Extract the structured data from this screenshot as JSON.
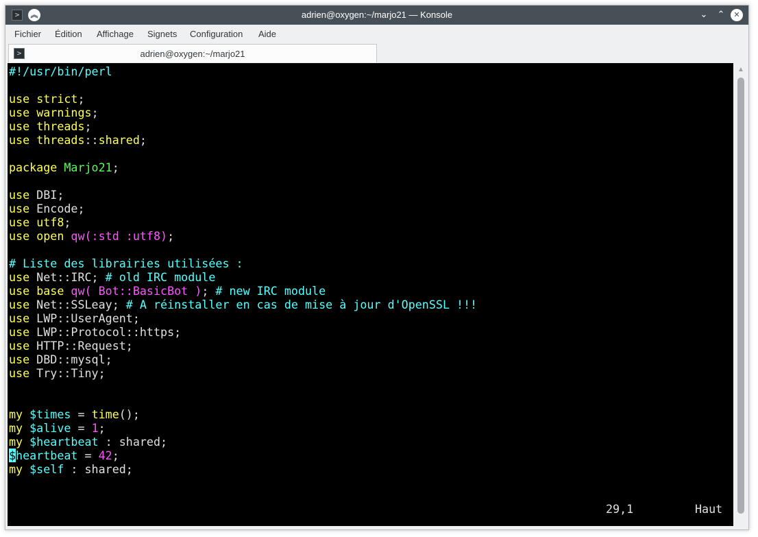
{
  "window": {
    "title": "adrien@oxygen:~/marjo21 — Konsole"
  },
  "menubar": {
    "items": [
      "Fichier",
      "Édition",
      "Affichage",
      "Signets",
      "Configuration",
      "Aide"
    ]
  },
  "tabs": [
    {
      "label": "adrien@oxygen:~/marjo21"
    }
  ],
  "terminal": {
    "lines": [
      "#!/usr/bin/perl",
      "",
      "use strict;",
      "use warnings;",
      "use threads;",
      "use threads::shared;",
      "",
      "package Marjo21;",
      "",
      "use DBI;",
      "use Encode;",
      "use utf8;",
      "use open qw(:std :utf8);",
      "",
      "# Liste des librairies utilisées :",
      "use Net::IRC; # old IRC module",
      "use base qw( Bot::BasicBot ); # new IRC module",
      "use Net::SSLeay; # A réinstaller en cas de mise à jour d'OpenSSL !!!",
      "use LWP::UserAgent;",
      "use LWP::Protocol::https;",
      "use HTTP::Request;",
      "use DBD::mysql;",
      "use Try::Tiny;",
      "",
      "",
      "my $times = time();",
      "my $alive = 1;",
      "my $heartbeat : shared;",
      "$heartbeat = 42;",
      "my $self : shared;"
    ],
    "status": {
      "position": "29,1",
      "scroll": "Haut"
    }
  },
  "colors": {
    "keyword": "#ffff54",
    "comment": "#54ffff",
    "string": "#ff54ff",
    "package": "#54ff54",
    "variable": "#54ffff",
    "text": "#e0e0e0",
    "background": "#000000",
    "titlebar": "#475057"
  },
  "icons": {
    "app": "terminal-icon",
    "keep_above": "keep-above-icon",
    "minimize": "chevron-down-icon",
    "maximize": "chevron-up-icon",
    "close": "close-icon"
  }
}
